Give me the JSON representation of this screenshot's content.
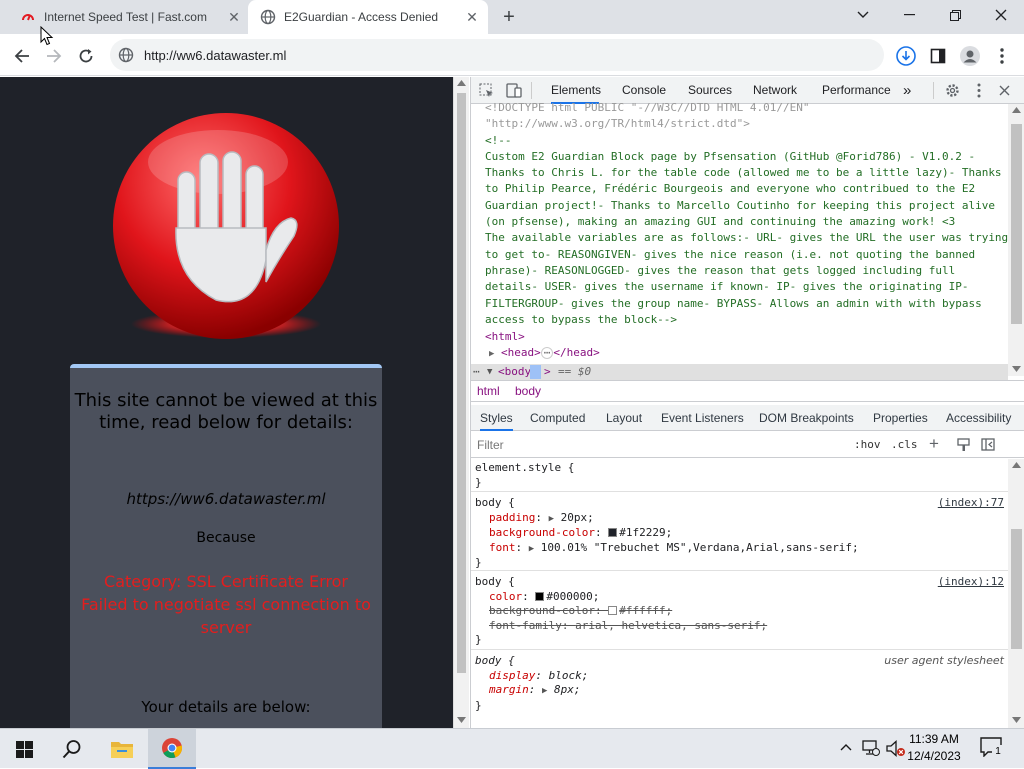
{
  "browser": {
    "tabs": [
      {
        "title": "Internet Speed Test | Fast.com",
        "icon": "fast-com-icon",
        "active": false
      },
      {
        "title": "E2Guardian - Access Denied",
        "icon": "globe-icon",
        "active": true
      }
    ],
    "new_tab_icon": "plus-icon",
    "url": "http://ww6.datawaster.ml"
  },
  "block_page": {
    "heading": "This site cannot be viewed at this time, read below for details:",
    "blocked_url": "https://ww6.datawaster.ml",
    "because": "Because",
    "reason_line1": "Category: SSL Certificate Error",
    "reason_line2": "Failed to negotiate ssl connection to server",
    "details_heading": "Your details are below:",
    "colors": {
      "background": "#1f2229",
      "card": "#4b505c",
      "card_border": "#a3c8f5",
      "reason": "#e41d1d"
    }
  },
  "devtools": {
    "tabs": [
      "Elements",
      "Console",
      "Sources",
      "Network",
      "Performance"
    ],
    "active_tab": "Elements",
    "dom": {
      "doctype_line1": "<!DOCTYPE html PUBLIC \"-//W3C//DTD HTML 4.01//EN\"",
      "doctype_line2": "\"http://www.w3.org/TR/html4/strict.dtd\">",
      "comment_open": "<!--",
      "comment_lines": [
        "Custom E2 Guardian Block page by Pfsensation (GitHub @Forid786) - V1.0.2 -",
        "Thanks to Chris L. for the table code (allowed me to be a little lazy)- Thanks",
        "to Philip Pearce, Frédéric Bourgeois and everyone who contribued to the E2",
        "Guardian project!- Thanks to Marcello Coutinho for keeping this project alive",
        "(on pfsense), making an amazing GUI and continuing the amazing work! <3",
        "The available variables are as follows:- URL- gives the URL the user was trying",
        "to get to- REASONGIVEN- gives the nice reason (i.e. not quoting the banned",
        "phrase)- REASONLOGGED- gives the reason that gets logged including full",
        "details- USER- gives the username if known- IP- gives the originating IP-",
        "FILTERGROUP- gives the group name- BYPASS- Allows an admin with with bypass",
        "access to bypass the block-->"
      ],
      "html_open": "<html>",
      "head_open": "<head>",
      "head_ellipsis": "⋯",
      "head_close": "</head>",
      "body_tag": "<body",
      "body_close": ">",
      "selected_marker": "== $0"
    },
    "breadcrumbs": [
      "html",
      "body"
    ],
    "style_tabs": [
      "Styles",
      "Computed",
      "Layout",
      "Event Listeners",
      "DOM Breakpoints",
      "Properties",
      "Accessibility"
    ],
    "filter_placeholder": "Filter",
    "hov": ":hov",
    "cls": ".cls",
    "rules": {
      "element_style": {
        "selector": "element.style {",
        "close": "}"
      },
      "body1": {
        "selector": "body {",
        "source": "(index):77",
        "padding_prop": "padding",
        "padding_val": "20px;",
        "bg_prop": "background-color",
        "bg_val": "#1f2229;",
        "bg_swatch": "#1f2229",
        "font_prop": "font",
        "font_val": "100.01% \"Trebuchet MS\",Verdana,Arial,sans-serif;",
        "close": "}"
      },
      "body2": {
        "selector": "body {",
        "source": "(index):12",
        "color_prop": "color",
        "color_val": "#000000;",
        "color_swatch": "#000000",
        "bg_prop": "background-color",
        "bg_val": "#ffffff;",
        "bg_swatch": "#ffffff",
        "ff_prop": "font-family",
        "ff_val": "arial, helvetica, sans-serif;",
        "close": "}"
      },
      "body3": {
        "selector": "body {",
        "source": "user agent stylesheet",
        "display_prop": "display",
        "display_val": "block;",
        "margin_prop": "margin",
        "margin_val": "8px;",
        "close": "}"
      }
    }
  },
  "taskbar": {
    "time": "11:39 AM",
    "date": "12/4/2023",
    "notification_count": "1"
  }
}
